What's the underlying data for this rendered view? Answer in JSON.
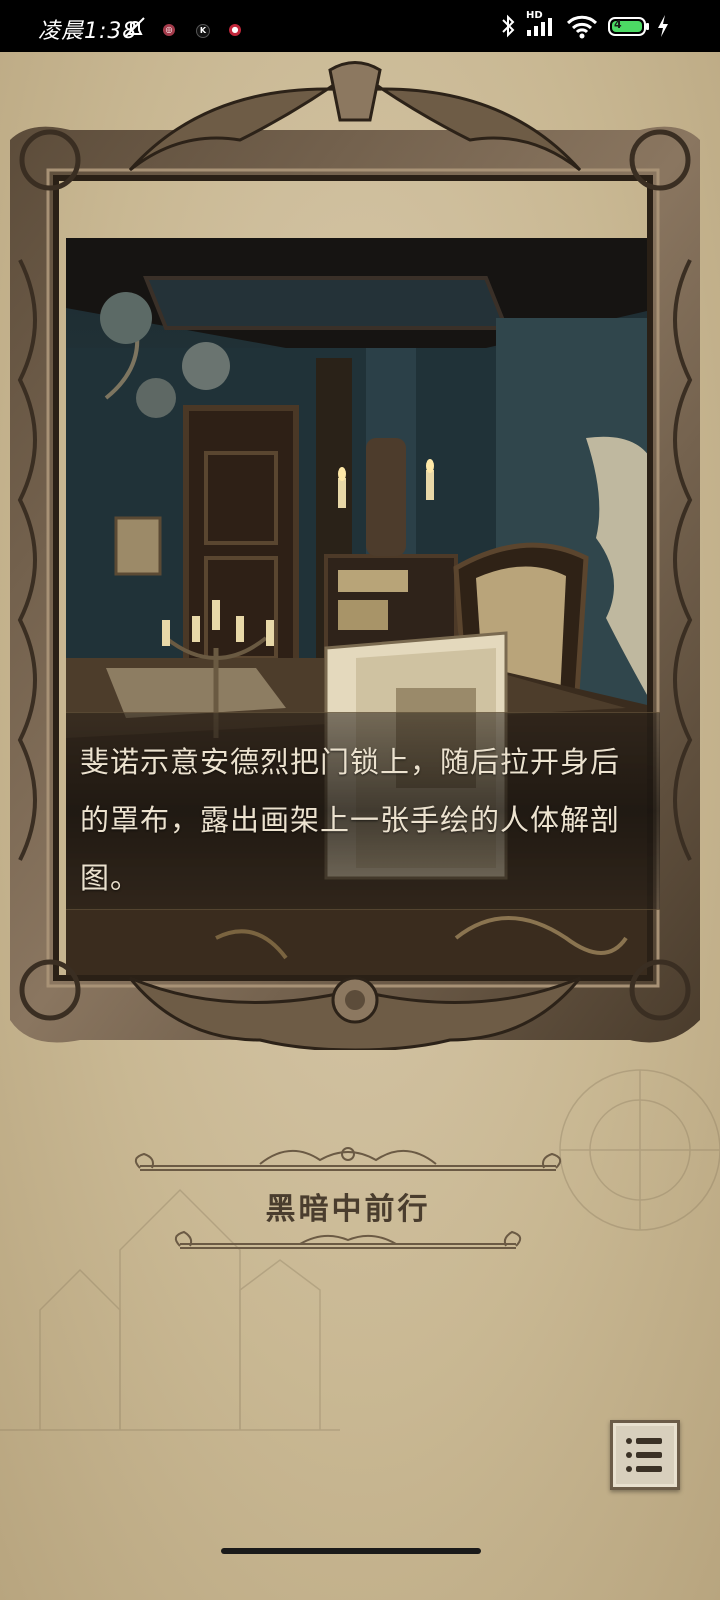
{
  "status_bar": {
    "time": "凌晨1:38",
    "network": "HD",
    "battery_level": "4",
    "colors": {
      "battery": "#4cd964"
    }
  },
  "story": {
    "dialog_text": "斐诺示意安德烈把门锁上，随后拉开身后的罩布，露出画架上一张手绘的人体解剖图。"
  },
  "chapter": {
    "title": "黑暗中前行"
  },
  "controls": {
    "menu_icon": "list-menu-icon"
  }
}
